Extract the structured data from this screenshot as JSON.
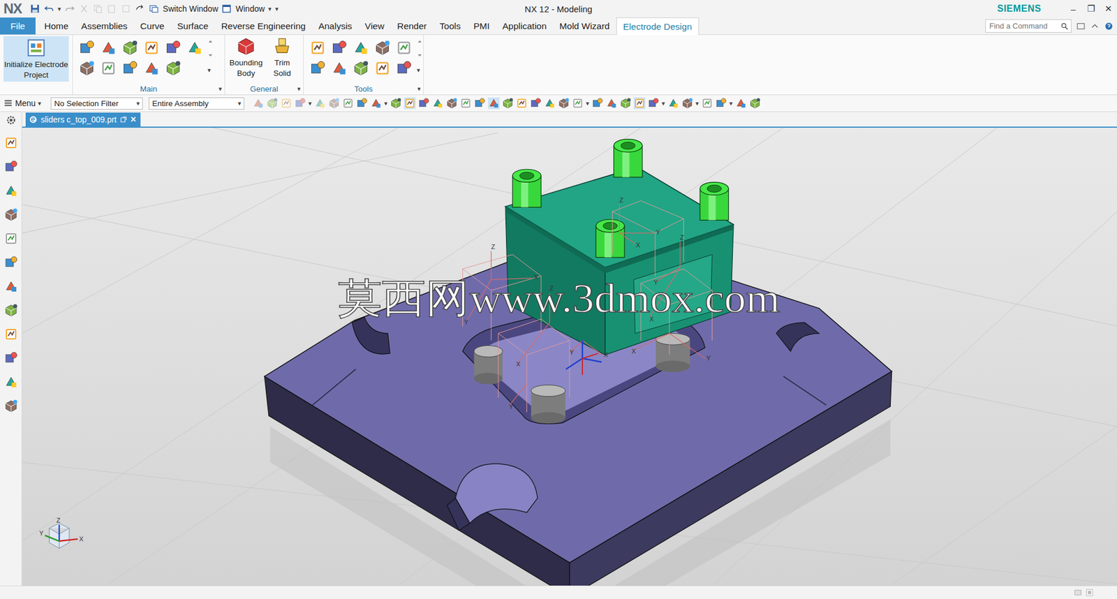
{
  "window": {
    "logo": "NX",
    "title": "NX 12 - Modeling",
    "brand": "SIEMENS",
    "controls": [
      "–",
      "❐",
      "✕"
    ]
  },
  "quick_access": {
    "switch_window": "Switch Window",
    "window_menu": "Window",
    "arrow": "▾"
  },
  "tabs": [
    {
      "label": "File",
      "selected": false,
      "kind": "file"
    },
    {
      "label": "Home",
      "selected": false,
      "kind": "tab"
    },
    {
      "label": "Assemblies",
      "selected": false,
      "kind": "tab"
    },
    {
      "label": "Curve",
      "selected": false,
      "kind": "tab"
    },
    {
      "label": "Surface",
      "selected": false,
      "kind": "tab"
    },
    {
      "label": "Reverse Engineering",
      "selected": false,
      "kind": "tab"
    },
    {
      "label": "Analysis",
      "selected": false,
      "kind": "tab"
    },
    {
      "label": "View",
      "selected": false,
      "kind": "tab"
    },
    {
      "label": "Render",
      "selected": false,
      "kind": "tab"
    },
    {
      "label": "Tools",
      "selected": false,
      "kind": "tab"
    },
    {
      "label": "PMI",
      "selected": false,
      "kind": "tab"
    },
    {
      "label": "Application",
      "selected": false,
      "kind": "tab"
    },
    {
      "label": "Mold Wizard",
      "selected": false,
      "kind": "tab"
    },
    {
      "label": "Electrode Design",
      "selected": true,
      "kind": "tab"
    }
  ],
  "search": {
    "placeholder": "Find a Command"
  },
  "ribbon": {
    "initialize": {
      "label": "Initialize Electrode Project",
      "selected": true
    },
    "groups": [
      {
        "label": "Main",
        "buttons": []
      },
      {
        "label": "General",
        "buttons": [
          "Bounding Body",
          "Trim Solid"
        ]
      },
      {
        "label": "Tools",
        "buttons": []
      }
    ],
    "arrow": "▾"
  },
  "command_bar": {
    "menu": "Menu",
    "selection_filter": "No Selection Filter",
    "scope": "Entire Assembly",
    "arrow": "▾"
  },
  "document_tab": {
    "label": "sliders c_top_009.prt",
    "close": "×",
    "selected": true
  },
  "viewport": {
    "watermark": "莫西网www.3dmox.com",
    "csys_labels": [
      "Z",
      "Y",
      "X",
      "Z",
      "X",
      "Y",
      "Z",
      "Y",
      "X",
      "Y",
      "X",
      "Z",
      "X",
      "Y",
      "Y",
      "X"
    ],
    "triad": [
      "Z",
      "Y",
      "X"
    ]
  }
}
